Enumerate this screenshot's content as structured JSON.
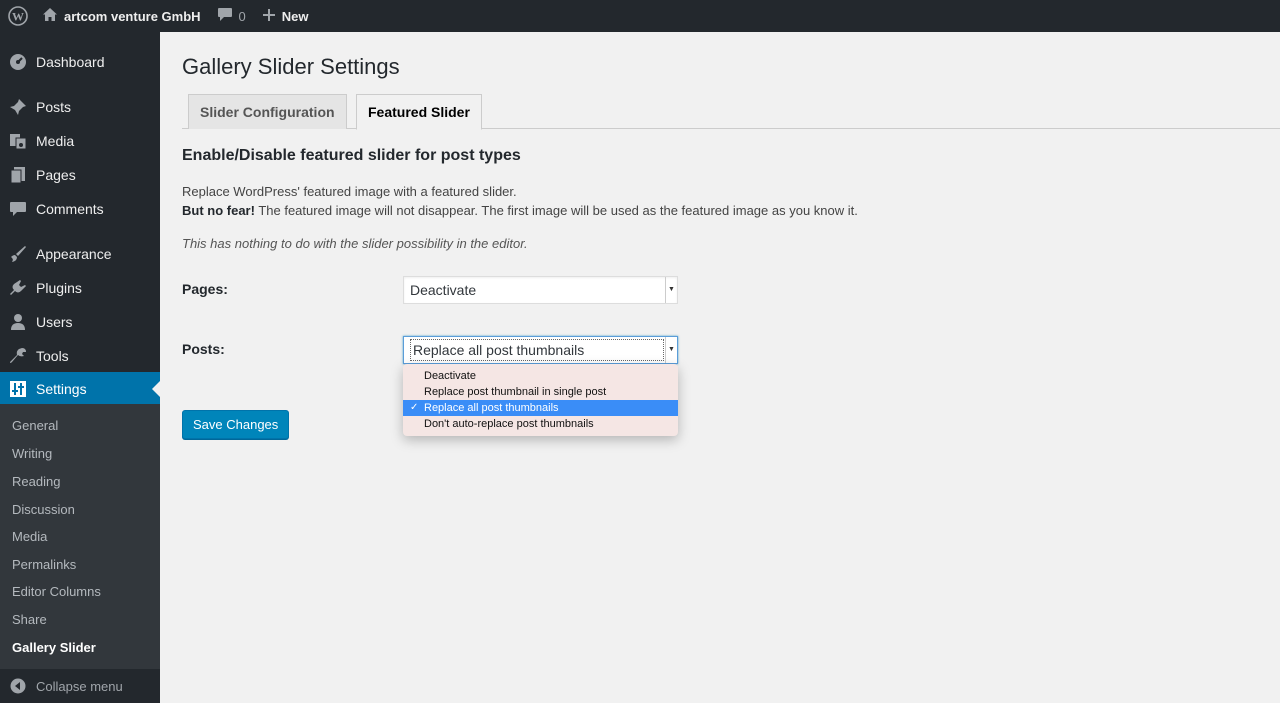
{
  "adminbar": {
    "site_name": "artcom venture GmbH",
    "comments_count": "0",
    "new_label": "New"
  },
  "sidebar": {
    "items": [
      {
        "label": "Dashboard",
        "icon": "dashboard-icon"
      },
      {
        "label": "Posts",
        "icon": "pin-icon"
      },
      {
        "label": "Media",
        "icon": "media-icon"
      },
      {
        "label": "Pages",
        "icon": "pages-icon"
      },
      {
        "label": "Comments",
        "icon": "comment-icon"
      },
      {
        "label": "Appearance",
        "icon": "brush-icon"
      },
      {
        "label": "Plugins",
        "icon": "plugin-icon"
      },
      {
        "label": "Users",
        "icon": "user-icon"
      },
      {
        "label": "Tools",
        "icon": "wrench-icon"
      },
      {
        "label": "Settings",
        "icon": "settings-icon",
        "active": true
      }
    ],
    "submenu": [
      "General",
      "Writing",
      "Reading",
      "Discussion",
      "Media",
      "Permalinks",
      "Editor Columns",
      "Share",
      "Gallery Slider"
    ],
    "submenu_current": "Gallery Slider",
    "collapse_label": "Collapse menu"
  },
  "main": {
    "title": "Gallery Slider Settings",
    "tabs": [
      {
        "label": "Slider Configuration",
        "active": false
      },
      {
        "label": "Featured Slider",
        "active": true
      }
    ],
    "section_title": "Enable/Disable featured slider for post types",
    "desc_line1": "Replace WordPress' featured image with a featured slider.",
    "desc_line2_bold": "But no fear!",
    "desc_line2_rest": " The featured image will not disappear. The first image will be used as the featured image as you know it.",
    "desc_note": "This has nothing to do with the slider possibility in the editor.",
    "pages_label": "Pages:",
    "pages_value": "Deactivate",
    "posts_label": "Posts:",
    "posts_value": "Replace all post thumbnails",
    "posts_options": [
      "Deactivate",
      "Replace post thumbnail in single post",
      "Replace all post thumbnails",
      "Don't auto-replace post thumbnails"
    ],
    "posts_selected_index": 2,
    "save_label": "Save Changes"
  },
  "colors": {
    "adminbar_bg": "#23282d",
    "accent": "#0073aa",
    "button": "#0085ba",
    "dropdown_highlight": "#3a8df7"
  }
}
